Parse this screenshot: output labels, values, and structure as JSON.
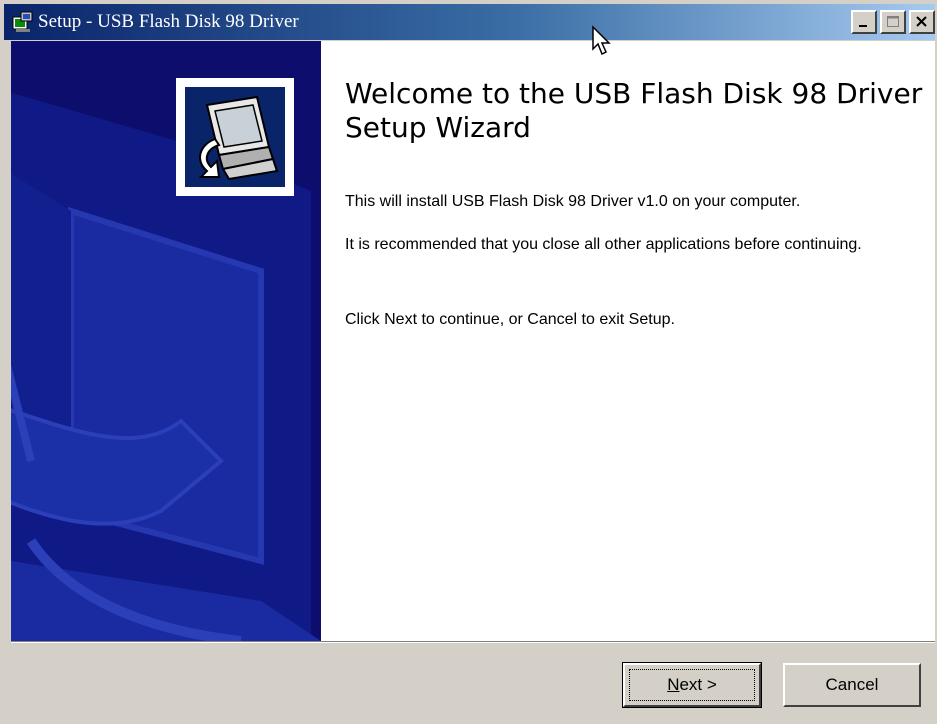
{
  "window": {
    "title": "Setup - USB Flash Disk 98 Driver",
    "controls": [
      "minimize-icon",
      "maximize-icon",
      "close-icon"
    ]
  },
  "welcome": {
    "heading": "Welcome to the USB Flash Disk 98 Driver Setup Wizard",
    "paragraphs": [
      "This will install USB Flash Disk 98 Driver v1.0 on your computer.",
      "It is recommended that you close all other applications before continuing.",
      "Click Next to continue, or Cancel to exit Setup."
    ]
  },
  "buttons": {
    "next": {
      "prefix": "",
      "access_key": "N",
      "suffix": "ext >"
    },
    "cancel": "Cancel"
  },
  "colors": {
    "titlebar_start": "#0a246a",
    "titlebar_end": "#a6caf0",
    "banner": "#0d0d6e",
    "face": "#d4d0c8"
  }
}
